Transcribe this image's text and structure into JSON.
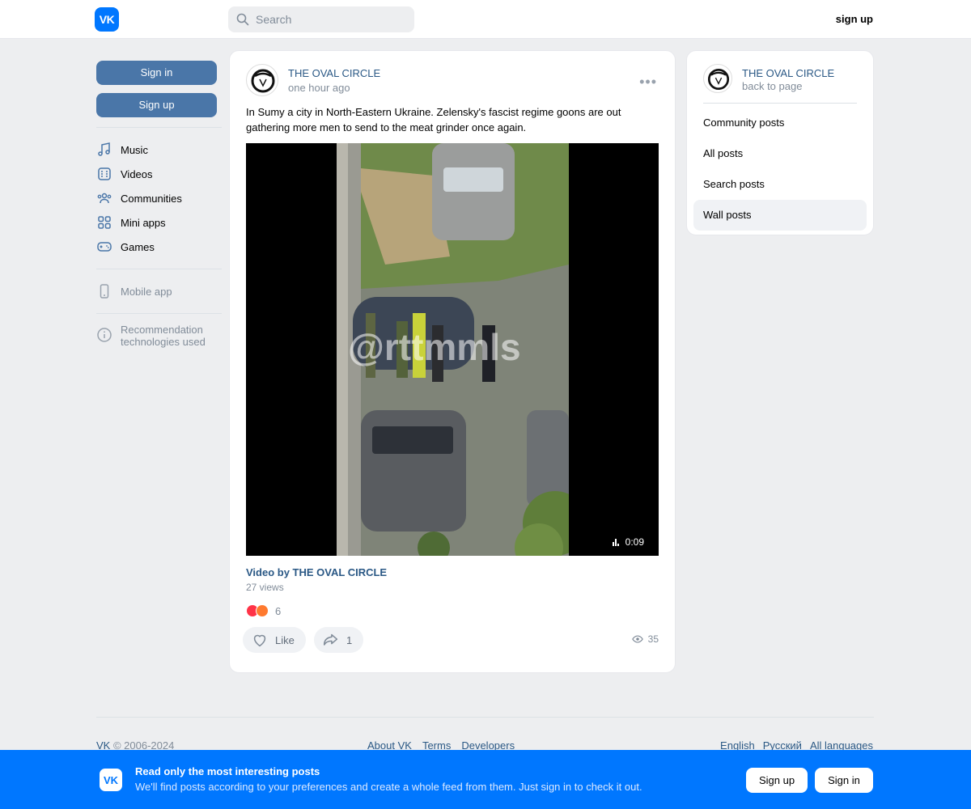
{
  "header": {
    "logo": "VK",
    "search_placeholder": "Search",
    "signup": "sign up"
  },
  "left_nav": {
    "signin": "Sign in",
    "signup": "Sign up",
    "items": [
      {
        "label": "Music",
        "icon": "music-icon"
      },
      {
        "label": "Videos",
        "icon": "videos-icon"
      },
      {
        "label": "Communities",
        "icon": "communities-icon"
      },
      {
        "label": "Mini apps",
        "icon": "mini-apps-icon"
      },
      {
        "label": "Games",
        "icon": "games-icon"
      }
    ],
    "mobile_app": "Mobile app",
    "recommendation": "Recommendation technologies used"
  },
  "post": {
    "author": "THE OVAL CIRCLE",
    "time": "one hour ago",
    "text": "In Sumy a city in North-Eastern Ukraine. Zelensky's fascist regime goons are out gathering more men to send to the meat grinder once again.",
    "video": {
      "watermark": "@rttmmls",
      "duration": "0:09",
      "title": "Video by THE OVAL CIRCLE",
      "views": "27 views"
    },
    "reactions_count": "6",
    "like_label": "Like",
    "share_count": "1",
    "views_count": "35"
  },
  "right_panel": {
    "name": "THE OVAL CIRCLE",
    "back": "back to page",
    "menu": [
      {
        "label": "Community posts",
        "active": false
      },
      {
        "label": "All posts",
        "active": false
      },
      {
        "label": "Search posts",
        "active": false
      },
      {
        "label": "Wall posts",
        "active": true
      }
    ]
  },
  "footer": {
    "brand": "VK",
    "copyright": "© 2006-2024",
    "links": [
      "About VK",
      "Terms",
      "Developers"
    ],
    "languages": [
      "English",
      "Русский",
      "All languages"
    ]
  },
  "banner": {
    "title": "Read only the most interesting posts",
    "subtitle": "We'll find posts according to your preferences and create a whole feed from them. Just sign in to check it out.",
    "signup": "Sign up",
    "signin": "Sign in"
  },
  "colors": {
    "brand": "#0077ff",
    "button": "#4a76a8",
    "link": "#2a5885",
    "muted": "#818c99"
  }
}
